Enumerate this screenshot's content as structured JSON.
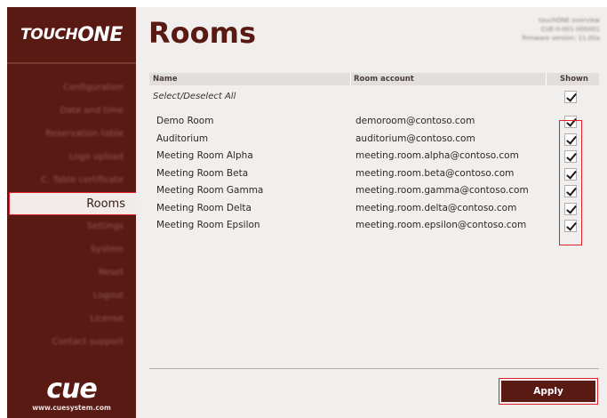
{
  "brand": {
    "logo_touch": "TOUCH",
    "logo_one": "ONE",
    "cue_logo": "cue",
    "cue_url": "www.cuesystem.com"
  },
  "header": {
    "title": "Rooms",
    "version_lines": [
      "touchONE overview",
      "CUE-0-001-000001",
      "firmware version: 11.00a"
    ]
  },
  "sidebar": {
    "items": [
      {
        "label": "Configuration"
      },
      {
        "label": "Date and time"
      },
      {
        "label": "Reservation table"
      },
      {
        "label": "Logo upload"
      },
      {
        "label": "C. Table certificate"
      },
      {
        "label": "Rooms"
      },
      {
        "label": "Settings"
      },
      {
        "label": "System"
      },
      {
        "label": "Reset"
      },
      {
        "label": "Logout"
      },
      {
        "label": "License"
      },
      {
        "label": "Contact support"
      }
    ],
    "active_index": 5
  },
  "table": {
    "columns": {
      "name": "Name",
      "account": "Room account",
      "shown": "Shown"
    },
    "select_all_label": "Select/Deselect All",
    "select_all_checked": true,
    "rows": [
      {
        "name": "Demo Room",
        "account": "demoroom@contoso.com",
        "shown": true
      },
      {
        "name": "Auditorium",
        "account": "auditorium@contoso.com",
        "shown": true
      },
      {
        "name": "Meeting Room Alpha",
        "account": "meeting.room.alpha@contoso.com",
        "shown": true
      },
      {
        "name": "Meeting Room Beta",
        "account": "meeting.room.beta@contoso.com",
        "shown": true
      },
      {
        "name": "Meeting Room Gamma",
        "account": "meeting.room.gamma@contoso.com",
        "shown": true
      },
      {
        "name": "Meeting Room Delta",
        "account": "meeting.room.delta@contoso.com",
        "shown": true
      },
      {
        "name": "Meeting Room Epsilon",
        "account": "meeting.room.epsilon@contoso.com",
        "shown": true
      }
    ]
  },
  "actions": {
    "apply_label": "Apply"
  },
  "colors": {
    "brand": "#5a1a14",
    "highlight": "#e0202a",
    "panel": "#f1efed"
  }
}
